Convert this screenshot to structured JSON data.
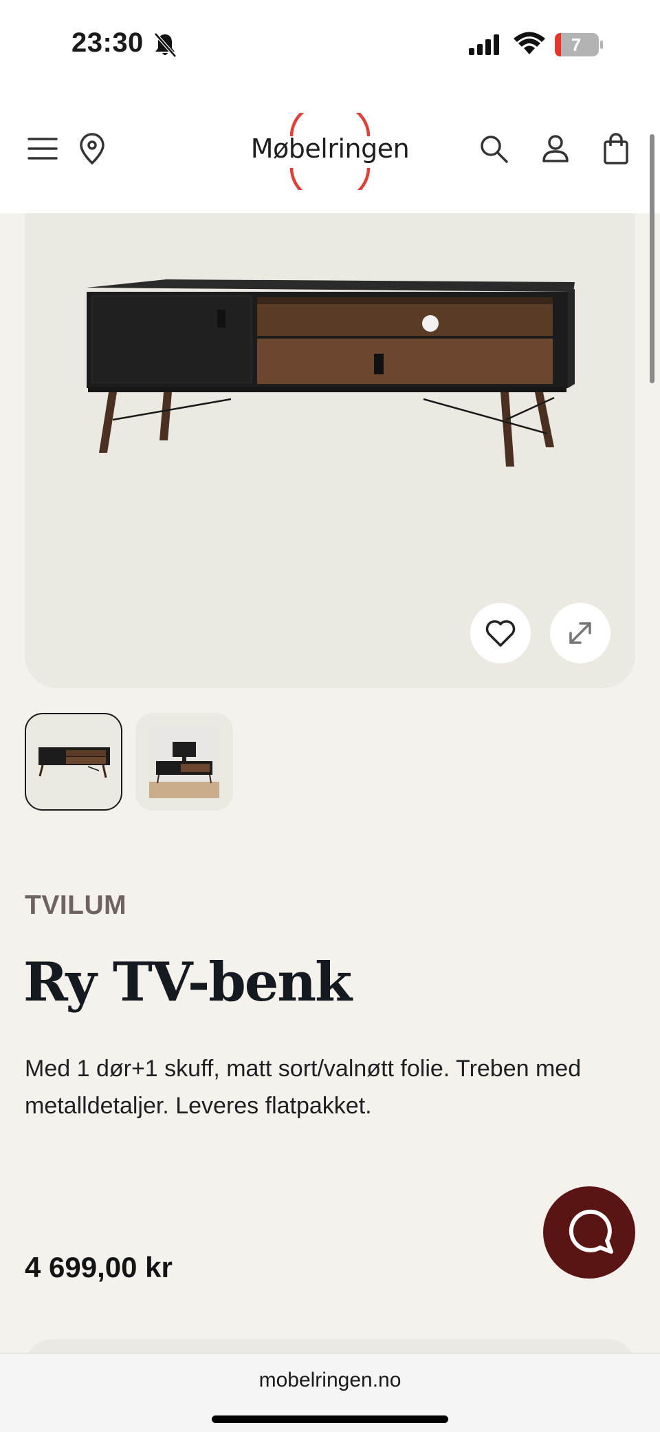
{
  "status_bar": {
    "time": "23:30",
    "battery_level": "7",
    "icons": [
      "bell-slash-icon",
      "signal-icon",
      "wifi-icon",
      "battery-icon"
    ]
  },
  "header": {
    "logo_text": "Møbelringen",
    "icons": [
      "menu-icon",
      "location-icon",
      "search-icon",
      "account-icon",
      "cart-icon"
    ],
    "logo_ring_color": "#e0403a"
  },
  "gallery": {
    "image_count": 2,
    "selected_index": 0,
    "actions": [
      "heart-icon",
      "expand-icon"
    ]
  },
  "product": {
    "brand": "TVILUM",
    "title": "Ry TV-benk",
    "description": "Med 1 dør+1 skuff, matt sort/valnøtt folie. Treben med metalldetaljer. Leveres flatpakket.",
    "price": "4 699,00 kr"
  },
  "chat": {
    "icon": "chat-icon",
    "color": "#5b1414"
  },
  "browser": {
    "url": "mobelringen.no"
  }
}
